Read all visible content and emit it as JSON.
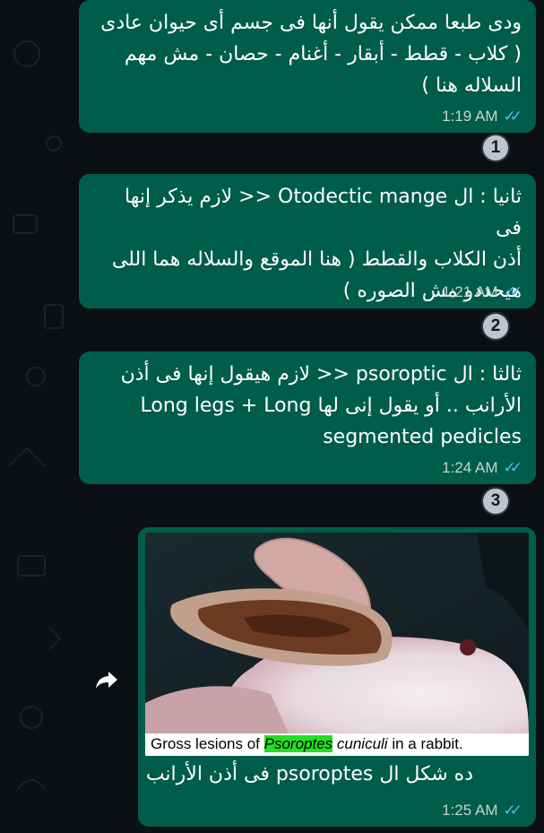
{
  "messages": [
    {
      "lines": [
        "ودى طبعا ممكن يقول أنها فى جسم أى حيوان عادى",
        "( كلاب - قطط - أبقار - أغنام - حصان - مش مهم",
        "السلاله هنا )"
      ],
      "time": "1:19 AM",
      "badge": "1"
    },
    {
      "lines": [
        "ثانيا : ال Otodectic mange << لازم يذكر إنها فى",
        "أذن الكلاب والقطط ( هنا الموقع والسلاله هما اللى",
        "هيحددو مش الصوره )"
      ],
      "time": "1:21 AM",
      "badge": "2"
    },
    {
      "lines": [
        "ثالثا : ال psoroptic << لازم هيقول إنها فى أذن",
        "الأرانب .. أو يقول إنى لها Long legs + Long",
        "segmented pedicles"
      ],
      "time": "1:24 AM",
      "badge": "3"
    }
  ],
  "image_message": {
    "caption_prefix": "Gross lesions of ",
    "caption_highlight": "Psoroptes",
    "caption_species": "cuniculi",
    "caption_suffix": " in a rabbit.",
    "text": "ده شكل ال psoroptes فى أذن الأرانب",
    "time": "1:25 AM"
  },
  "icons": {
    "read_receipt": "double-check-icon",
    "forward": "forward-arrow-icon"
  },
  "colors": {
    "outgoing_bubble": "#005c4b",
    "background": "#0b1014",
    "read_ticks": "#53bdeb",
    "caption_highlight": "#22e022"
  }
}
